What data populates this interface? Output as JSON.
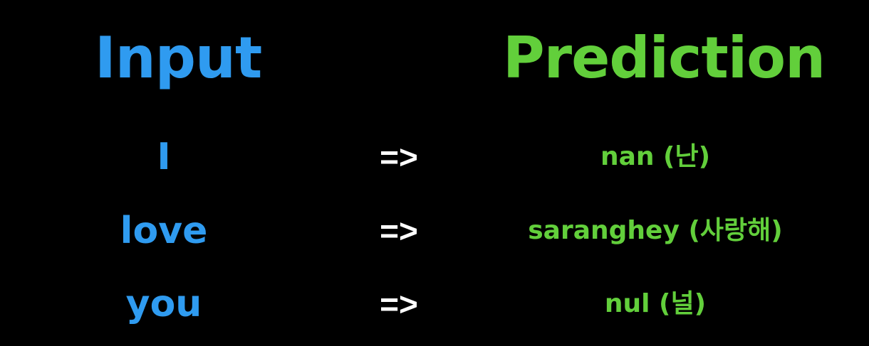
{
  "colors": {
    "background": "#000000",
    "input": "#2f9bf0",
    "prediction": "#62cf3b",
    "arrow": "#ffffff"
  },
  "headers": {
    "input": "Input",
    "prediction": "Prediction"
  },
  "rows": [
    {
      "input": "I",
      "arrow": "=>",
      "prediction": "nan (난)"
    },
    {
      "input": "love",
      "arrow": "=>",
      "prediction": "saranghey (사랑해)"
    },
    {
      "input": "you",
      "arrow": "=>",
      "prediction": "nul (널)"
    }
  ]
}
